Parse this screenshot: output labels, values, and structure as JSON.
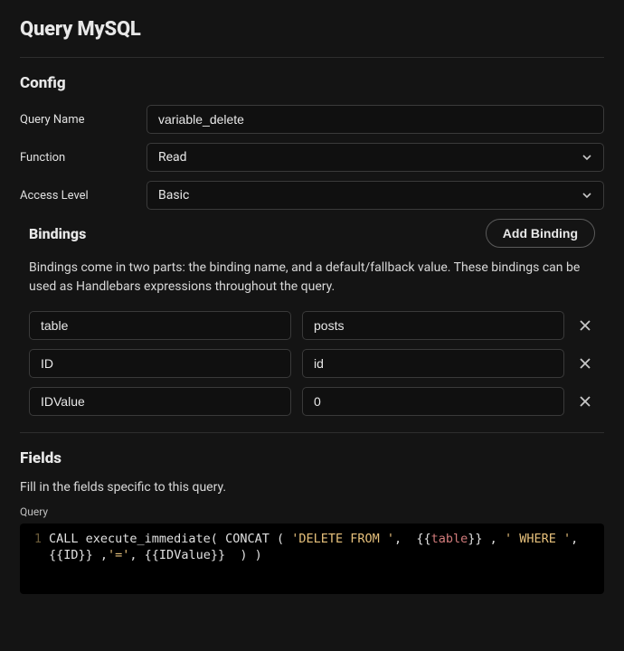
{
  "page_title": "Query MySQL",
  "config": {
    "heading": "Config",
    "query_name": {
      "label": "Query Name",
      "value": "variable_delete"
    },
    "function": {
      "label": "Function",
      "value": "Read"
    },
    "access": {
      "label": "Access Level",
      "value": "Basic"
    }
  },
  "bindings": {
    "heading": "Bindings",
    "add_button": "Add Binding",
    "help_text": "Bindings come in two parts: the binding name, and a default/fallback value. These bindings can be used as Handlebars expressions throughout the query.",
    "rows": [
      {
        "name": "table",
        "default": "posts"
      },
      {
        "name": "ID",
        "default": "id"
      },
      {
        "name": "IDValue",
        "default": "0"
      }
    ]
  },
  "fields": {
    "heading": "Fields",
    "description": "Fill in the fields specific to this query.",
    "query_label": "Query",
    "line_no": "1",
    "tokens": {
      "t0": "CALL execute_immediate( CONCAT ( ",
      "s0": "'DELETE FROM '",
      "t1": ",  {{",
      "v0": "table",
      "t2": "}} , ",
      "s1": "' WHERE '",
      "t3": ", {{ID}} ,",
      "s2": "'='",
      "t4": ", {{IDValue}}  ) )"
    }
  }
}
